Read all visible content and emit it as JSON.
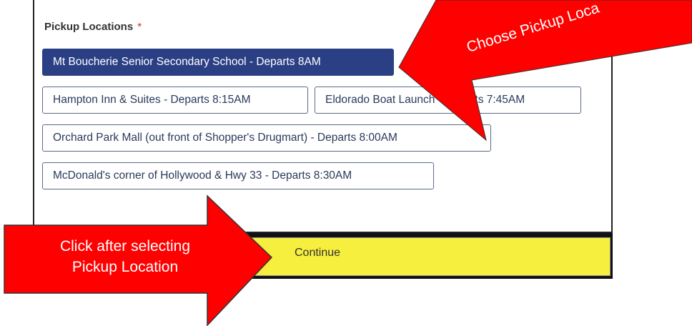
{
  "form": {
    "section_label": "Pickup Locations",
    "required_marker": "*",
    "options": [
      {
        "label": "Mt Boucherie Senior Secondary School - Departs 8AM",
        "selected": true
      },
      {
        "label": "Hampton Inn & Suites - Departs 8:15AM",
        "selected": false
      },
      {
        "label": "Eldorado Boat Launch - Departs 7:45AM",
        "selected": false
      },
      {
        "label": "Orchard Park Mall (out front of Shopper's Drugmart) - Departs 8:00AM",
        "selected": false
      },
      {
        "label": "McDonald's corner of Hollywood & Hwy 33 - Departs 8:30AM",
        "selected": false
      }
    ],
    "continue_label": "Continue"
  },
  "annotations": {
    "top_right_text": "Choose Pickup Loca",
    "left_line1": "Click after selecting",
    "left_line2": "Pickup Location"
  },
  "colors": {
    "selected_bg": "#2b3f85",
    "continue_bg": "#f6ef3d",
    "arrow_red": "#ff0000",
    "required": "#d32f2f"
  }
}
